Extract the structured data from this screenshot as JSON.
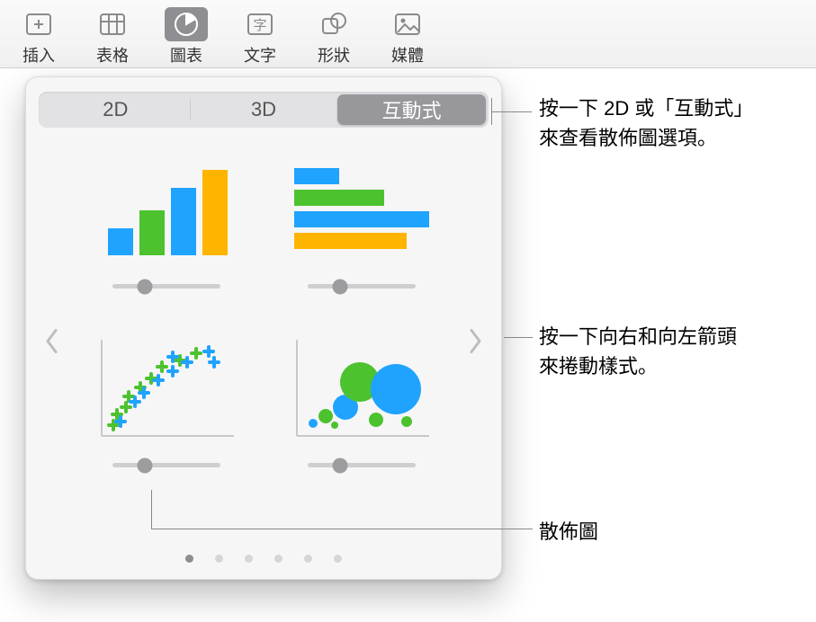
{
  "toolbar": {
    "items": [
      {
        "label": "插入",
        "icon": "insert-icon"
      },
      {
        "label": "表格",
        "icon": "table-icon"
      },
      {
        "label": "圖表",
        "icon": "chart-icon",
        "selected": true
      },
      {
        "label": "文字",
        "icon": "text-icon"
      },
      {
        "label": "形狀",
        "icon": "shape-icon"
      },
      {
        "label": "媒體",
        "icon": "media-icon"
      }
    ]
  },
  "popover": {
    "segments": {
      "two_d": "2D",
      "three_d": "3D",
      "interactive": "互動式"
    },
    "charts": [
      {
        "name": "interactive-column-chart"
      },
      {
        "name": "interactive-bar-chart"
      },
      {
        "name": "interactive-scatter-chart"
      },
      {
        "name": "interactive-bubble-chart"
      }
    ],
    "page_count": 6,
    "active_page": 0
  },
  "callouts": {
    "seg_hint_l1": "按一下 2D 或「互動式」",
    "seg_hint_l2": "來查看散佈圖選項。",
    "arrow_hint_l1": "按一下向右和向左箭頭",
    "arrow_hint_l2": "來捲動樣式。",
    "scatter_label": "散佈圖"
  },
  "colors": {
    "blue": "#1fa3ff",
    "green": "#4cc22f",
    "yellow": "#ffb400"
  }
}
